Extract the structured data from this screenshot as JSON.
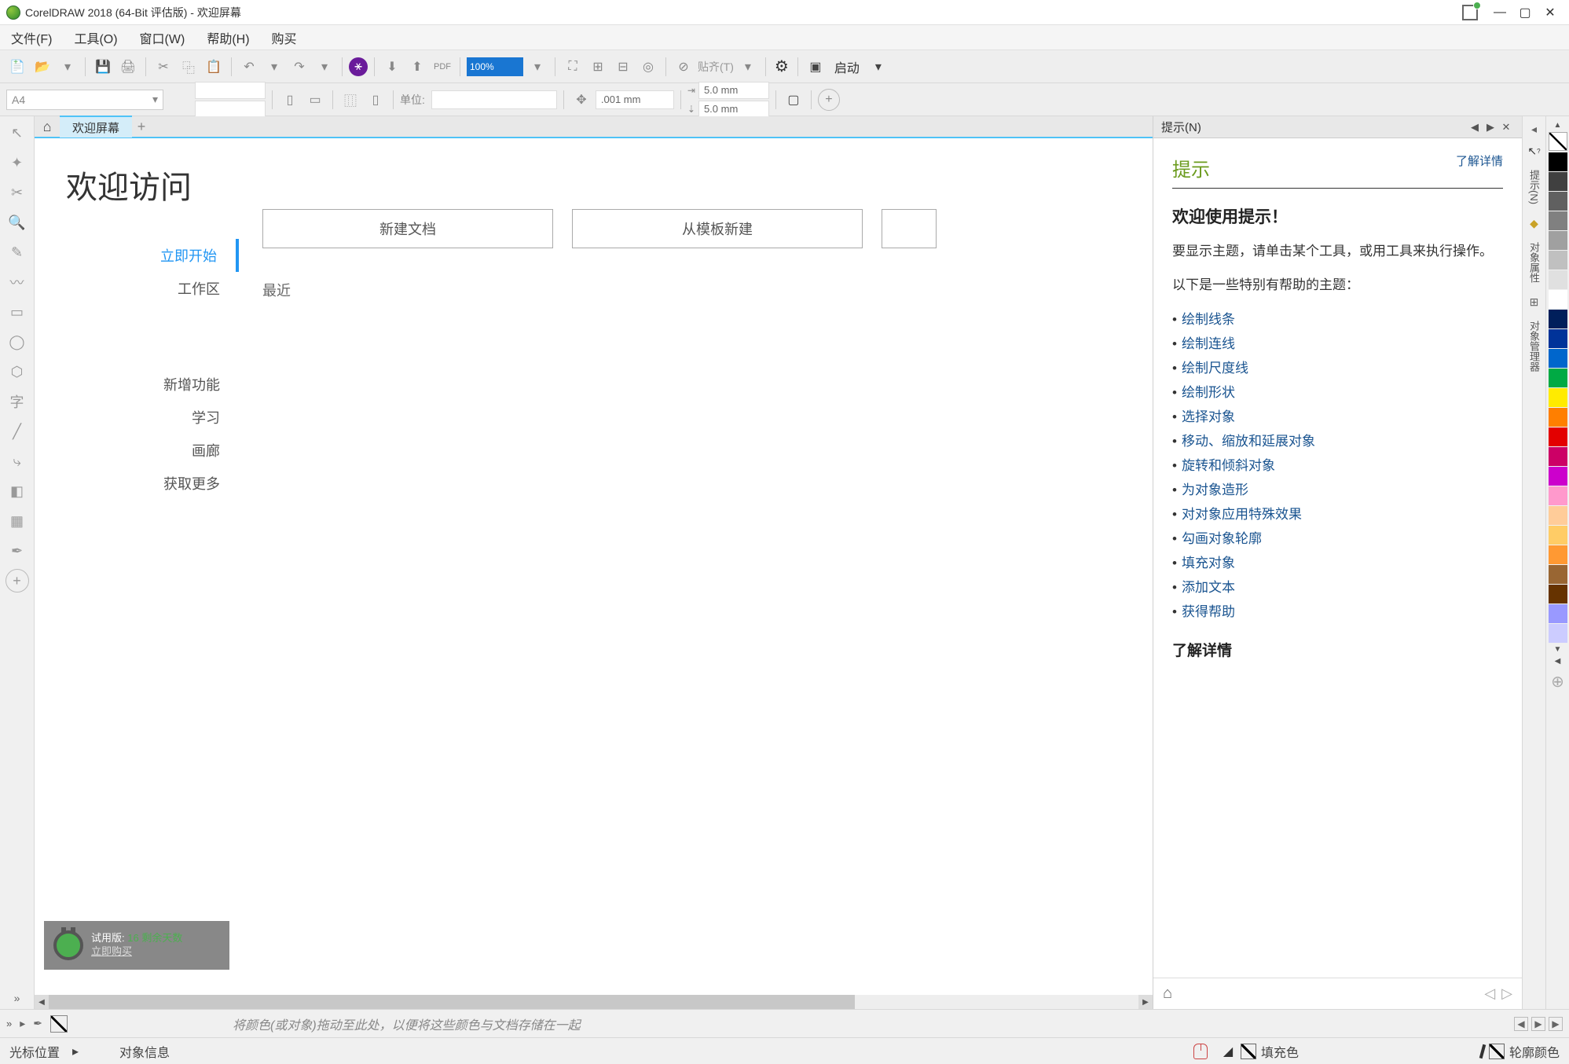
{
  "titlebar": {
    "title": "CorelDRAW 2018 (64-Bit 评估版) - 欢迎屏幕"
  },
  "menubar": {
    "items": [
      "文件(F)",
      "工具(O)",
      "窗口(W)",
      "帮助(H)",
      "购买"
    ]
  },
  "toolbar1": {
    "zoom": "100%",
    "snap_label": "贴齐(T)",
    "launch_label": "启动"
  },
  "toolbar2": {
    "paper": "A4",
    "unit_label": "单位:",
    "nudge": ".001 mm",
    "dup_x": "5.0 mm",
    "dup_y": "5.0 mm"
  },
  "tabs": {
    "active": "欢迎屏幕"
  },
  "welcome": {
    "heading": "欢迎访问",
    "nav": {
      "get_started": "立即开始",
      "workspace": "工作区",
      "whats_new": "新增功能",
      "learning": "学习",
      "gallery": "画廊",
      "get_more": "获取更多"
    },
    "trial": {
      "label": "试用版:",
      "days": "16 剩余天数",
      "buy": "立即购买"
    },
    "actions": {
      "new_doc": "新建文档",
      "from_template": "从模板新建"
    },
    "recent": "最近"
  },
  "hints": {
    "panel_title": "提示(N)",
    "title": "提示",
    "learn_more": "了解详情",
    "h2": "欢迎使用提示！",
    "intro1": "要显示主题，请单击某个工具，或用工具来执行操作。",
    "intro2": "以下是一些特别有帮助的主题：",
    "links": [
      "绘制线条",
      "绘制连线",
      "绘制尺度线",
      "绘制形状",
      "选择对象",
      "移动、缩放和延展对象",
      "旋转和倾斜对象",
      "为对象造形",
      "对对象应用特殊效果",
      "勾画对象轮廓",
      "填充对象",
      "添加文本",
      "获得帮助"
    ],
    "footer_h": "了解详情"
  },
  "right_dock": {
    "items": [
      "提示(N)",
      "对象属性",
      "对象管理器"
    ]
  },
  "color_palette": [
    "#000000",
    "#404040",
    "#606060",
    "#808080",
    "#a0a0a0",
    "#c0c0c0",
    "#e0e0e0",
    "#ffffff",
    "#001f5b",
    "#003399",
    "#0066cc",
    "#00aa44",
    "#ffeb00",
    "#ff7f00",
    "#e30000",
    "#cc0066",
    "#cc00cc",
    "#ff99cc",
    "#ffcc99",
    "#ffcc66",
    "#ff9933",
    "#996633",
    "#663300",
    "#9999ff",
    "#ccccff"
  ],
  "colortray": {
    "hint": "将颜色(或对象)拖动至此处，以便将这些颜色与文档存储在一起"
  },
  "statusbar": {
    "cursor": "光标位置",
    "object_info": "对象信息",
    "fill": "填充色",
    "outline": "轮廓颜色"
  }
}
